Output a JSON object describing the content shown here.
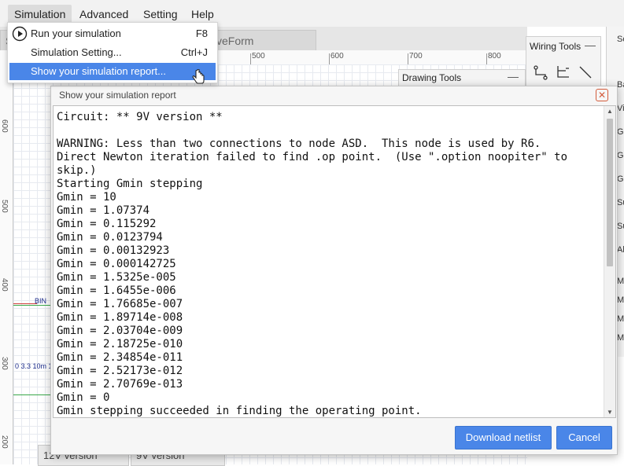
{
  "menubar": {
    "items": [
      "Simulation",
      "Advanced",
      "Setting",
      "Help"
    ]
  },
  "simulation_menu": {
    "items": [
      {
        "label": "Run your simulation",
        "shortcut": "F8"
      },
      {
        "label": "Simulation Setting...",
        "shortcut": "Ctrl+J"
      },
      {
        "label": "Show your simulation report...",
        "shortcut": ""
      }
    ],
    "highlighted_index": 2
  },
  "tabs": [
    {
      "label": "S"
    },
    {
      "label": "veForm"
    }
  ],
  "ruler": {
    "top_labels": [
      "500",
      "600",
      "700",
      "800"
    ],
    "left_labels": [
      "600",
      "500",
      "400",
      "300",
      "200"
    ]
  },
  "wiring_tools": {
    "title": "Wiring Tools",
    "minimize": "—",
    "tools": [
      "elbow-wire-icon",
      "tee-wire-icon",
      "diagonal-line-icon"
    ]
  },
  "drawing_tools": {
    "title": "Drawing Tools",
    "minimize": "—"
  },
  "side_panel": {
    "header": "Sc",
    "items": [
      "Ba",
      "Vi",
      "G",
      "G",
      "G",
      "Su",
      "Su",
      "Al",
      "M",
      "M",
      "M",
      "M"
    ]
  },
  "canvas": {
    "net_label": "BIN",
    "source_text": "0 3.3 10m 1"
  },
  "bottom_tabs": [
    "12V version",
    "9V version"
  ],
  "report_dialog": {
    "title": "Show your simulation report",
    "text": "Circuit: ** 9V version **\n\nWARNING: Less than two connections to node ASD.  This node is used by R6.\nDirect Newton iteration failed to find .op point.  (Use \".option noopiter\" to skip.)\nStarting Gmin stepping\nGmin = 10\nGmin = 1.07374\nGmin = 0.115292\nGmin = 0.0123794\nGmin = 0.00132923\nGmin = 0.000142725\nGmin = 1.5325e-005\nGmin = 1.6455e-006\nGmin = 1.76685e-007\nGmin = 1.89714e-008\nGmin = 2.03704e-009\nGmin = 2.18725e-010\nGmin = 2.34854e-011\nGmin = 2.52173e-012\nGmin = 2.70769e-013\nGmin = 0\nGmin stepping succeeded in finding the operating point.",
    "download_label": "Download netlist",
    "cancel_label": "Cancel",
    "close_glyph": "✕",
    "scroll_up": "▲",
    "scroll_down": "▼"
  },
  "colors": {
    "accent": "#4a86e8",
    "close": "#d35c3c",
    "wire": "#3aa84a"
  }
}
